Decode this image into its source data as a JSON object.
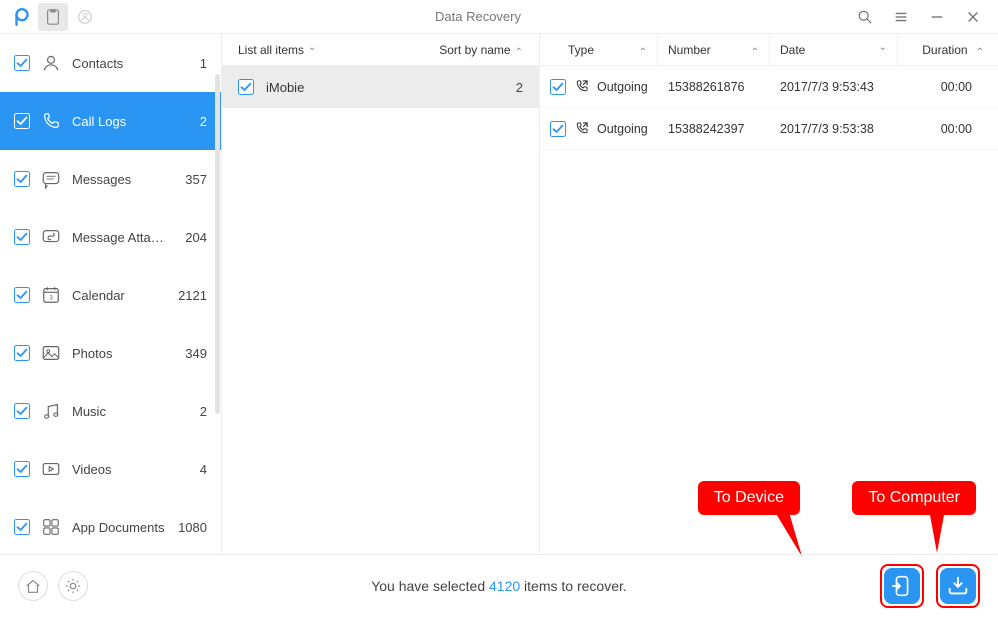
{
  "title": "Data Recovery",
  "sidebar": {
    "items": [
      {
        "label": "Contacts",
        "count": "1",
        "icon": "contact"
      },
      {
        "label": "Call Logs",
        "count": "2",
        "icon": "phone",
        "active": true
      },
      {
        "label": "Messages",
        "count": "357",
        "icon": "message"
      },
      {
        "label": "Message Attach...",
        "count": "204",
        "icon": "attach"
      },
      {
        "label": "Calendar",
        "count": "2121",
        "icon": "calendar"
      },
      {
        "label": "Photos",
        "count": "349",
        "icon": "photo"
      },
      {
        "label": "Music",
        "count": "2",
        "icon": "music"
      },
      {
        "label": "Videos",
        "count": "4",
        "icon": "video"
      },
      {
        "label": "App Documents",
        "count": "1080",
        "icon": "appdoc"
      }
    ]
  },
  "middle": {
    "list_label": "List all items",
    "sort_label": "Sort by name",
    "rows": [
      {
        "name": "iMobie",
        "count": "2"
      }
    ]
  },
  "detail": {
    "headers": {
      "type": "Type",
      "number": "Number",
      "date": "Date",
      "duration": "Duration"
    },
    "rows": [
      {
        "type": "Outgoing",
        "number": "15388261876",
        "date": "2017/7/3 9:53:43",
        "duration": "00:00"
      },
      {
        "type": "Outgoing",
        "number": "15388242397",
        "date": "2017/7/3 9:53:38",
        "duration": "00:00"
      }
    ]
  },
  "footer": {
    "pre": "You have selected ",
    "count": "4120",
    "post": " items to recover."
  },
  "tooltips": {
    "device": "To Device",
    "computer": "To Computer"
  }
}
